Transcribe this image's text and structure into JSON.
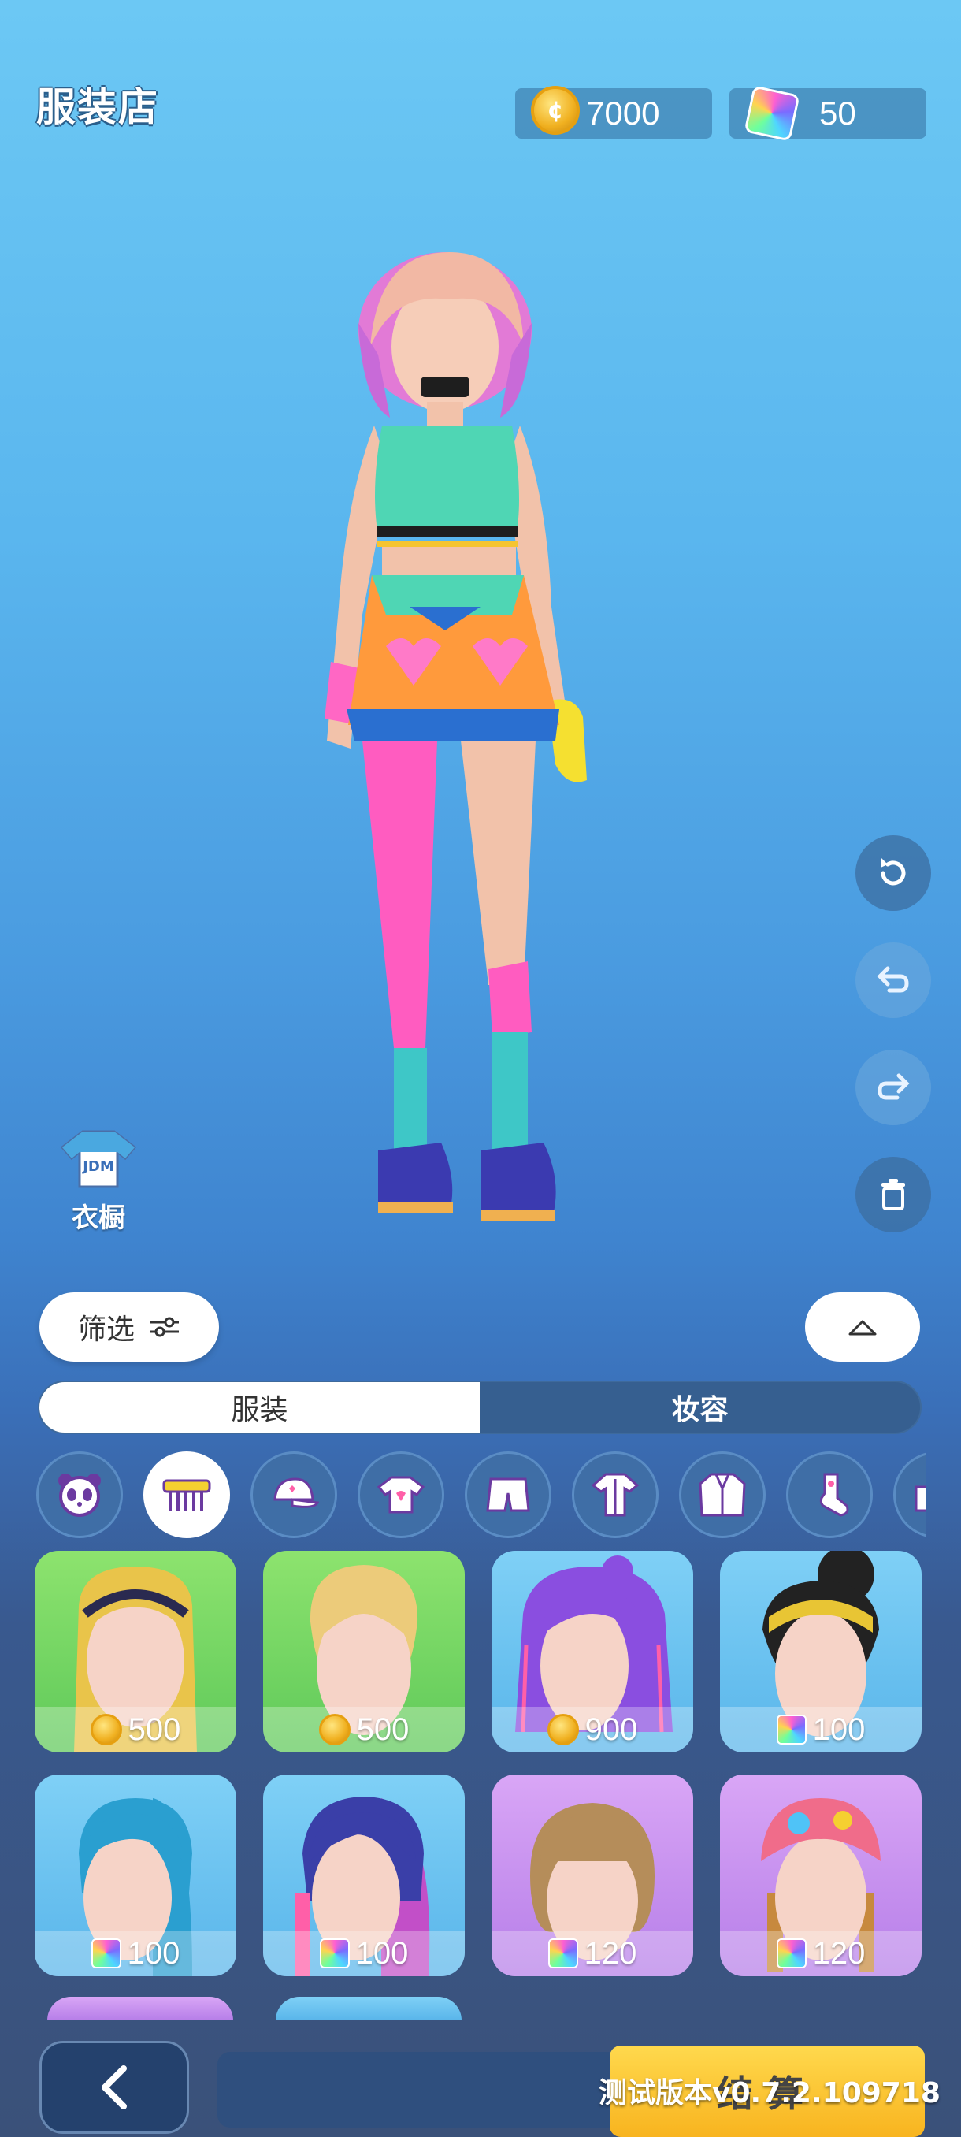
{
  "header": {
    "title": "服装店",
    "coins": "7000",
    "gems": "50"
  },
  "wardrobe": {
    "label": "衣橱",
    "shirt_text": "JDM"
  },
  "filter": {
    "label": "筛选"
  },
  "tabs": [
    {
      "label": "服装",
      "selected": true
    },
    {
      "label": "妆容",
      "selected": false
    }
  ],
  "categories": [
    {
      "icon": "panda-icon",
      "selected": false
    },
    {
      "icon": "comb-icon",
      "selected": true
    },
    {
      "icon": "cap-icon",
      "selected": false
    },
    {
      "icon": "tshirt-icon",
      "selected": false
    },
    {
      "icon": "shorts-icon",
      "selected": false
    },
    {
      "icon": "outfit-icon",
      "selected": false
    },
    {
      "icon": "jacket-icon",
      "selected": false
    },
    {
      "icon": "sock-icon",
      "selected": false
    },
    {
      "icon": "shoe-icon",
      "selected": false
    }
  ],
  "items": [
    {
      "name": "blonde-headband-hair",
      "price": "500",
      "currency": "coin",
      "bg": "green",
      "hair": "#e9c44a"
    },
    {
      "name": "blonde-slick-hair",
      "price": "500",
      "currency": "coin",
      "bg": "green",
      "hair": "#eccb7a"
    },
    {
      "name": "purple-braid-hair",
      "price": "900",
      "currency": "coin",
      "bg": "blue",
      "hair": "#8a4ee0"
    },
    {
      "name": "black-curly-bun-hair",
      "price": "100",
      "currency": "gem",
      "bg": "blue",
      "hair": "#222222"
    },
    {
      "name": "blue-ponytail-hair",
      "price": "100",
      "currency": "gem",
      "bg": "blue",
      "hair": "#2a9fd0"
    },
    {
      "name": "navy-pink-ponytail-hair",
      "price": "100",
      "currency": "gem",
      "bg": "blue",
      "hair": "#3a3fa8"
    },
    {
      "name": "brown-bob-hair",
      "price": "120",
      "currency": "gem",
      "bg": "purple",
      "hair": "#b58d5a"
    },
    {
      "name": "bandana-braids-hair",
      "price": "120",
      "currency": "gem",
      "bg": "purple",
      "hair": "#c7893e"
    }
  ],
  "bottom": {
    "back_icon": "chevron-left-icon",
    "checkout": "结算",
    "version": "测试版本v0.7.2.109718"
  },
  "colors": {
    "accent": "#f8b41f",
    "panel": "#365f90"
  }
}
